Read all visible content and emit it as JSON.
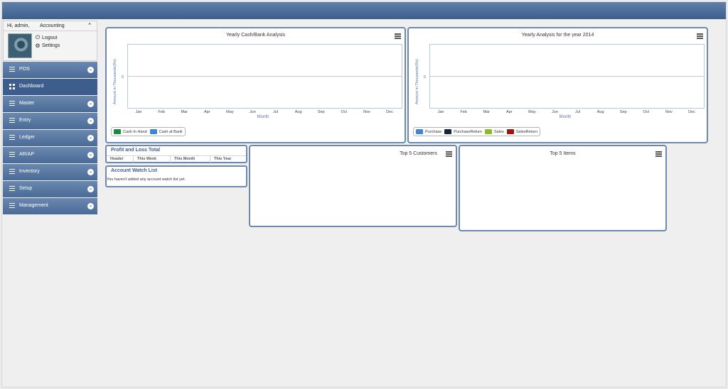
{
  "user": {
    "greeting": "Hi, admin,",
    "role": "Accounting",
    "caret": "^",
    "logout_label": "Logout",
    "settings_label": "Settings"
  },
  "menu": [
    {
      "label": "POS",
      "icon": "list-icon",
      "expandable": true
    },
    {
      "label": "Dashboard",
      "icon": "grid-icon",
      "expandable": false
    },
    {
      "label": "Master",
      "icon": "list-icon",
      "expandable": true
    },
    {
      "label": "Entry",
      "icon": "list-icon",
      "expandable": true
    },
    {
      "label": "Ledger",
      "icon": "list-icon",
      "expandable": true
    },
    {
      "label": "AR/AP",
      "icon": "list-icon",
      "expandable": true
    },
    {
      "label": "Inventory",
      "icon": "list-icon",
      "expandable": true
    },
    {
      "label": "Setup",
      "icon": "list-icon",
      "expandable": true
    },
    {
      "label": "Management",
      "icon": "list-icon",
      "expandable": true
    }
  ],
  "months": [
    "Jan",
    "Feb",
    "Mar",
    "Apr",
    "May",
    "Jun",
    "Jul",
    "Aug",
    "Sep",
    "Oct",
    "Nov",
    "Dec"
  ],
  "cash_chart": {
    "title": "Yearly Cash/Bank Analysis",
    "ylabel": "Amount in Thousands(Rs)",
    "xlabel": "Month",
    "zero": "0",
    "legend": [
      {
        "name": "Cash In Hand",
        "color": "#1e8a3c"
      },
      {
        "name": "Cash at Bank",
        "color": "#3f86d0"
      }
    ]
  },
  "yearly_chart": {
    "title": "Yearly Analysis for the year 2014",
    "ylabel": "Amount in Thousands(Rs)",
    "xlabel": "Month",
    "zero": "0",
    "legend": [
      {
        "name": "Purchase",
        "color": "#3f86d0"
      },
      {
        "name": "PurchaseReturn",
        "color": "#15253a"
      },
      {
        "name": "Sales",
        "color": "#8dbb2a"
      },
      {
        "name": "SalesReturn",
        "color": "#9e1414"
      }
    ]
  },
  "chart_data": [
    {
      "type": "line",
      "title": "Yearly Cash/Bank Analysis",
      "xlabel": "Month",
      "ylabel": "Amount in Thousands(Rs)",
      "categories": [
        "Jan",
        "Feb",
        "Mar",
        "Apr",
        "May",
        "Jun",
        "Jul",
        "Aug",
        "Sep",
        "Oct",
        "Nov",
        "Dec"
      ],
      "series": [
        {
          "name": "Cash In Hand",
          "values": []
        },
        {
          "name": "Cash at Bank",
          "values": []
        }
      ],
      "y_ticks": [
        "0"
      ],
      "legend": "bottom-left"
    },
    {
      "type": "line",
      "title": "Yearly Analysis for the year 2014",
      "xlabel": "Month",
      "ylabel": "Amount in Thousands(Rs)",
      "categories": [
        "Jan",
        "Feb",
        "Mar",
        "Apr",
        "May",
        "Jun",
        "Jul",
        "Aug",
        "Sep",
        "Oct",
        "Nov",
        "Dec"
      ],
      "series": [
        {
          "name": "Purchase",
          "values": []
        },
        {
          "name": "PurchaseReturn",
          "values": []
        },
        {
          "name": "Sales",
          "values": []
        },
        {
          "name": "SalesReturn",
          "values": []
        }
      ],
      "y_ticks": [
        "0"
      ],
      "legend": "bottom-left"
    }
  ],
  "profit_loss": {
    "title": "Profit and Loss Total",
    "columns": [
      "Header",
      "This Week",
      "This Month",
      "This Year"
    ]
  },
  "watch_list": {
    "title": "Account Watch List",
    "message": "You haven't added any account watch list yet."
  },
  "top_customers": {
    "title": "Top 5 Customers"
  },
  "top_items": {
    "title": "Top 5 Items"
  }
}
